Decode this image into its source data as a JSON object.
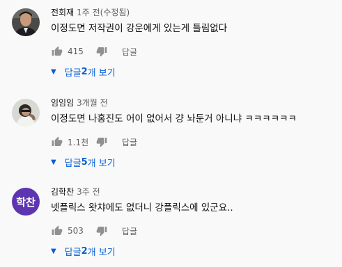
{
  "comments": [
    {
      "author": "전회재",
      "time": "1주 전(수정됨)",
      "text": "이정도면 저작권이 강운에게 있는게 틀림없다",
      "likes": "415",
      "reply_label": "답글",
      "replies_prefix": "답글 ",
      "replies_count": "2",
      "replies_suffix": "개 보기",
      "avatar": "photo"
    },
    {
      "author": "임임임",
      "time": "3개월 전",
      "text": "이정도면 나홍진도 어이 없어서 걍 놔둔거 아니냐 ㅋㅋㅋㅋㅋㅋ",
      "likes": "1.1천",
      "reply_label": "답글",
      "replies_prefix": "답글 ",
      "replies_count": "5",
      "replies_suffix": "개 보기",
      "avatar": "photo"
    },
    {
      "author": "김학찬",
      "time": "3주 전",
      "text": "넷플릭스 왓챠에도 없더니 강플릭스에 있군요..",
      "likes": "503",
      "reply_label": "답글",
      "replies_prefix": "답글 ",
      "replies_count": "2",
      "replies_suffix": "개 보기",
      "avatar_initials": "학찬",
      "avatar_color": "#5e35b1"
    }
  ],
  "icons": {
    "like": "thumb-up-icon",
    "dislike": "thumb-down-icon",
    "expand": "caret-down-icon"
  },
  "colors": {
    "link": "#065fd4",
    "secondary": "#606060",
    "background": "#f9f9f9"
  }
}
